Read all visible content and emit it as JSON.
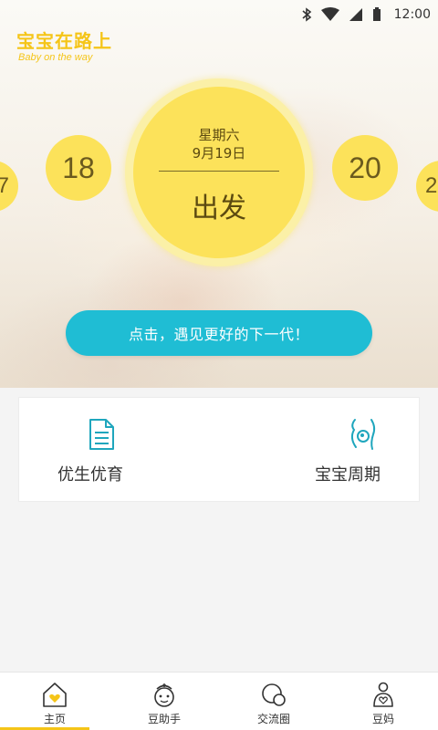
{
  "status_bar": {
    "time": "12:00"
  },
  "logo": {
    "title": "宝宝在路上",
    "subtitle": "Baby on the way"
  },
  "date_picker": {
    "prev_edge": "7",
    "prev": "18",
    "weekday": "星期六",
    "date": "9月19日",
    "action": "出发",
    "next": "20",
    "next_edge": "2"
  },
  "cta": {
    "label": "点击，遇见更好的下一代！"
  },
  "features": [
    {
      "label": "优生优育",
      "icon": "document-icon"
    },
    {
      "label": "宝宝周期",
      "icon": "pregnancy-icon"
    }
  ],
  "tabs": [
    {
      "label": "主页",
      "icon": "home-heart-icon",
      "active": true
    },
    {
      "label": "豆助手",
      "icon": "nurse-icon",
      "active": false
    },
    {
      "label": "交流圈",
      "icon": "chat-circles-icon",
      "active": false
    },
    {
      "label": "豆妈",
      "icon": "mom-icon",
      "active": false
    }
  ],
  "colors": {
    "accent_yellow": "#fce25a",
    "brand_yellow": "#f5c518",
    "cta_blue": "#1fbdd4",
    "icon_teal": "#1fa6bd"
  }
}
